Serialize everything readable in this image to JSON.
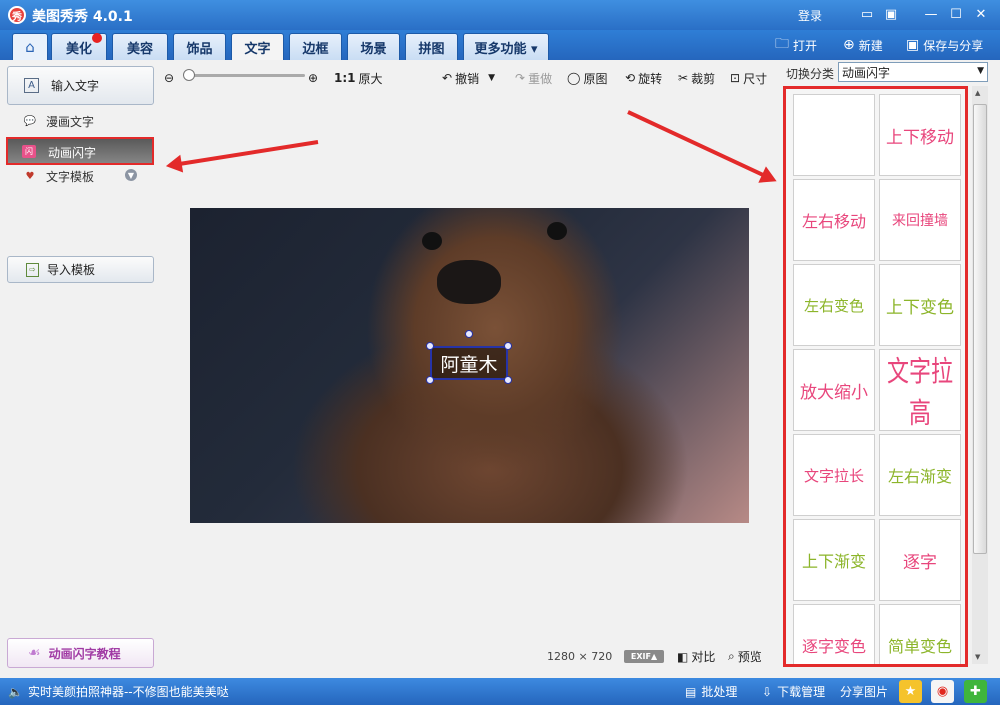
{
  "app": {
    "title": "美图秀秀 4.0.1",
    "logo_char": "秀",
    "login": "登录"
  },
  "window_controls": [
    "feedback-icon",
    "skin-icon",
    "minimize-icon",
    "maximize-icon",
    "close-icon"
  ],
  "nav": {
    "tabs": [
      "美化",
      "美容",
      "饰品",
      "文字",
      "边框",
      "场景",
      "拼图",
      "更多功能 ▾"
    ],
    "active_tab": "文字",
    "open": "打开",
    "new": "新建",
    "save_share": "保存与分享"
  },
  "left_panel": {
    "input_text": "输入文字",
    "comic_text": "漫画文字",
    "animated_text": "动画闪字",
    "text_template": "文字模板",
    "import_template": "导入模板",
    "tutorial": "动画闪字教程"
  },
  "toolbar": {
    "ratio": "1:1",
    "original_size": "原大",
    "undo": "撤销",
    "redo": "重做",
    "original": "原图",
    "rotate": "旋转",
    "crop": "裁剪",
    "size": "尺寸"
  },
  "canvas": {
    "overlay_text": "阿童木",
    "image_dimensions": "1280 × 720",
    "exif": "EXIF▲",
    "compare": "对比",
    "preview": "预览"
  },
  "right_panel": {
    "switch_category_label": "切换分类",
    "category": "动画闪字",
    "effects": [
      {
        "label": "",
        "color": "#e8467c",
        "size": 17
      },
      {
        "label": "上下移动",
        "color": "#e8467c",
        "size": 17
      },
      {
        "label": "左右移动",
        "color": "#e8467c",
        "size": 16
      },
      {
        "label": "来回撞墙",
        "color": "#e8467c",
        "size": 14
      },
      {
        "label": "左右变色",
        "color": "#8cb52a",
        "size": 15
      },
      {
        "label": "上下变色",
        "color": "#8cb52a",
        "size": 17
      },
      {
        "label": "放大缩小",
        "color": "#e8467c",
        "size": 17
      },
      {
        "label": "文字拉高",
        "color": "#e8467c",
        "size": 26
      },
      {
        "label": "文字拉长",
        "color": "#e8467c",
        "size": 15
      },
      {
        "label": "左右渐变",
        "color": "#8cb52a",
        "size": 16
      },
      {
        "label": "上下渐变",
        "color": "#8cb52a",
        "size": 16
      },
      {
        "label": "逐字",
        "color": "#e8467c",
        "size": 17
      },
      {
        "label": "逐字变色",
        "color": "#e8467c",
        "size": 16
      },
      {
        "label": "简单变色",
        "color": "#8cb52a",
        "size": 16
      }
    ]
  },
  "statusbar": {
    "tagline": "实时美颜拍照神器--不修图也能美美哒",
    "batch": "批处理",
    "download": "下载管理",
    "share": "分享图片"
  },
  "colors": {
    "accent_blue": "#2a74c9",
    "highlight_red": "#e32a2a",
    "pink": "#e8467c",
    "green": "#8cb52a"
  }
}
